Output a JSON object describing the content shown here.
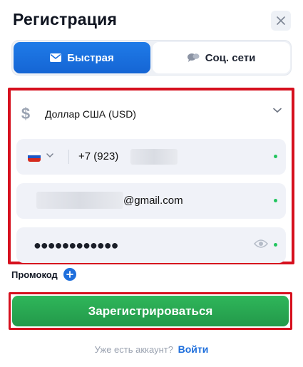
{
  "header": {
    "title": "Регистрация",
    "close_icon": "close-icon"
  },
  "tabs": [
    {
      "label": "Быстрая",
      "icon": "envelope-icon",
      "active": true
    },
    {
      "label": "Соц. сети",
      "icon": "chat-bubbles-icon",
      "active": false
    }
  ],
  "form": {
    "currency": {
      "icon": "dollar-icon",
      "value": "Доллар США (USD)"
    },
    "phone": {
      "country_flag": "russia-flag-icon",
      "prefix": "+7 (923)"
    },
    "email": {
      "suffix": "@gmail.com"
    },
    "password": {
      "masked": "●●●●●●●●●●●●",
      "eye_icon": "eye-icon"
    }
  },
  "promo": {
    "label": "Промокод",
    "icon": "plus-circle-icon"
  },
  "submit": {
    "label": "Зарегистрироваться"
  },
  "footer": {
    "question": "Уже есть аккаунт?",
    "login_link": "Войти"
  },
  "colors": {
    "primary_blue": "#1f6fdc",
    "submit_green": "#2fb65a",
    "highlight_red": "#d6101e",
    "status_green": "#22c55e"
  }
}
